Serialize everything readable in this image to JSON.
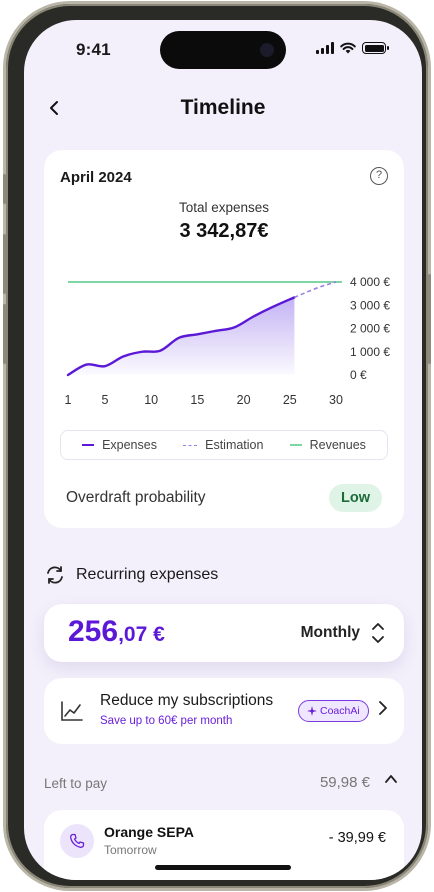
{
  "status_bar": {
    "time": "9:41"
  },
  "header": {
    "title": "Timeline"
  },
  "summary": {
    "month": "April 2024",
    "total_label": "Total expenses",
    "total_value": "3 342,87€"
  },
  "chart_data": {
    "type": "line",
    "x_ticks": [
      "1",
      "5",
      "10",
      "15",
      "20",
      "25",
      "30"
    ],
    "y_ticks": [
      "4 000 €",
      "3 000 €",
      "2 000 €",
      "1 000 €",
      "0 €"
    ],
    "ylim": [
      0,
      4000
    ],
    "xlim": [
      1,
      30
    ],
    "series": [
      {
        "name": "Expenses",
        "color": "#5b18d6",
        "x": [
          1,
          3,
          5,
          7,
          9,
          11,
          13,
          15,
          17,
          19,
          21,
          23,
          25.5
        ],
        "y": [
          0,
          450,
          380,
          800,
          1000,
          1050,
          1600,
          1750,
          1900,
          2050,
          2500,
          2900,
          3340
        ]
      },
      {
        "name": "Estimation",
        "color": "#9a7fe0",
        "x": [
          25.5,
          28,
          30
        ],
        "y": [
          3340,
          3750,
          4000
        ]
      },
      {
        "name": "Revenues",
        "color": "#7fd6a4",
        "x": [
          1,
          30
        ],
        "y": [
          4000,
          4000
        ]
      }
    ]
  },
  "legend": {
    "expenses": "Expenses",
    "estimation": "Estimation",
    "revenues": "Revenues"
  },
  "overdraft": {
    "label": "Overdraft probability",
    "value": "Low"
  },
  "recurring": {
    "title": "Recurring expenses",
    "amount_int": "256",
    "amount_dec": ",07 €",
    "period": "Monthly"
  },
  "coach": {
    "title": "Reduce my subscriptions",
    "subtitle": "Save up to 60€ per month",
    "badge": "CoachAi"
  },
  "left_to_pay": {
    "label": "Left to pay",
    "value": "59,98 €"
  },
  "payment": {
    "name": "Orange SEPA",
    "date": "Tomorrow",
    "amount": "- 39,99 €"
  },
  "colors": {
    "accent": "#5b18d6",
    "revenue": "#7fd6a4",
    "background": "#f3f0fb"
  }
}
